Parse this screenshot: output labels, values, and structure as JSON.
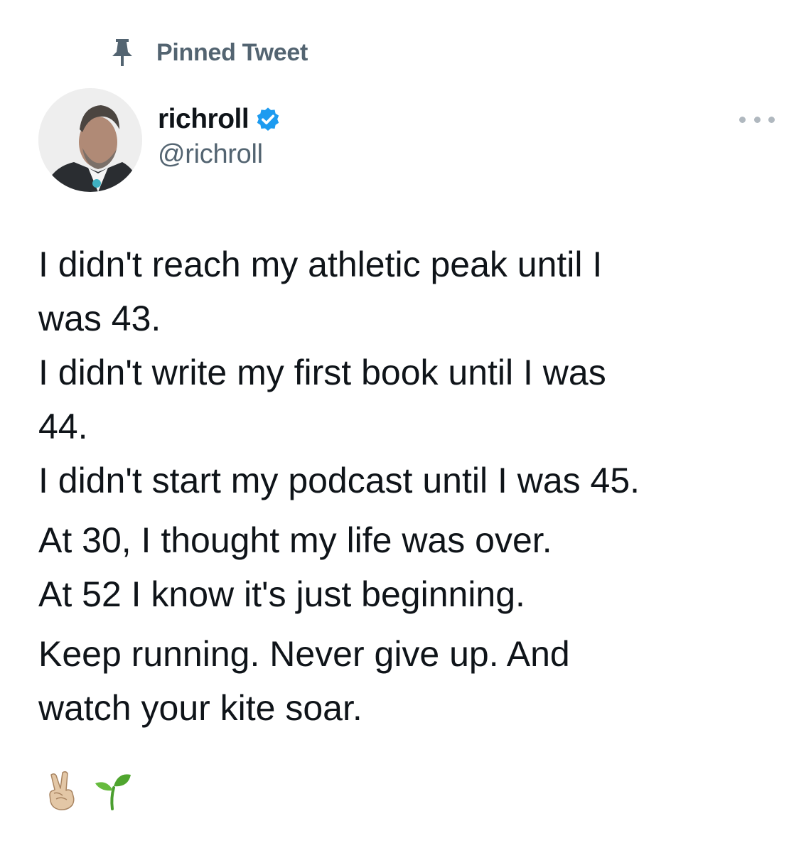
{
  "pinned": {
    "label": "Pinned Tweet",
    "icon": "pin-icon"
  },
  "author": {
    "display_name": "richroll",
    "handle": "@richroll",
    "verified": true,
    "verified_color": "#1d9bf0"
  },
  "tweet": {
    "paragraphs": [
      {
        "lines": [
          "I didn't reach my athletic peak until I",
          "was 43.",
          "I didn't write my first book until I was",
          "44.",
          "I didn't start my podcast until I was 45."
        ]
      },
      {
        "lines": [
          "At 30, I thought my life was over.",
          "At 52 I know it's just beginning."
        ]
      },
      {
        "lines": [
          "Keep running. Never give up. And",
          "watch your kite soar."
        ]
      }
    ],
    "emojis": [
      "victory-hand-emoji",
      "seedling-emoji"
    ]
  },
  "colors": {
    "text_primary": "#0f1419",
    "text_secondary": "#536471",
    "background": "#ffffff"
  }
}
